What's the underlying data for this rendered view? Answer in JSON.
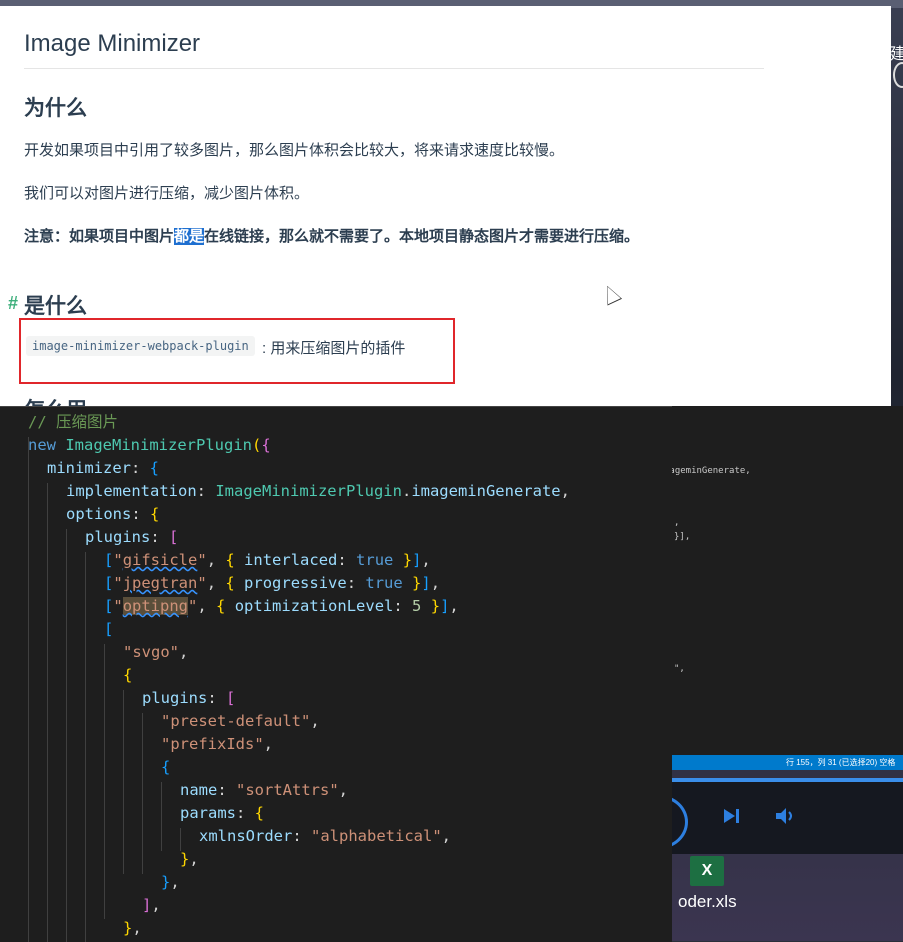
{
  "doc": {
    "title": "Image Minimizer",
    "sections": {
      "why": {
        "heading": "为什么",
        "p1": "开发如果项目中引用了较多图片，那么图片体积会比较大，将来请求速度比较慢。",
        "p2": "我们可以对图片进行压缩，减少图片体积。",
        "note_prefix": "注意：如果项目中图片",
        "note_highlight": "都是",
        "note_suffix": "在线链接，那么就不需要了。本地项目静态图片才需要进行压缩。"
      },
      "what": {
        "anchor": "#",
        "heading": "是什么",
        "code": "image-minimizer-webpack-plugin",
        "desc": ": 用来压缩图片的插件"
      },
      "how": {
        "heading_partial": "怎么用"
      }
    }
  },
  "code_editor": {
    "lines": [
      "// 压缩图片",
      "new ImageMinimizerPlugin({",
      "minimizer: {",
      "implementation: ImageMinimizerPlugin.imageminGenerate,",
      "options: {",
      "plugins: [",
      "[\"gifsicle\", { interlaced: true }],",
      "[\"jpegtran\", { progressive: true }],",
      "[\"optipng\", { optimizationLevel: 5 }],",
      "[",
      "\"svgo\",",
      "{",
      "plugins: [",
      "\"preset-default\",",
      "\"prefixIds\",",
      "{",
      "name: \"sortAttrs\",",
      "params: {",
      "xmlnsOrder: \"alphabetical\",",
      "},",
      "},",
      "],",
      "},"
    ]
  },
  "background": {
    "ide_snippets": [
      "mageminGenerate,",
      ",",
      "}],",
      "\","
    ],
    "status_bar": "行 155，列 31 (已选择20)   空格",
    "taskbar_file": "oder.xls",
    "xls_icon_letter": "X",
    "side_char": "建"
  },
  "colors": {
    "doc_text": "#2c3e50",
    "selection_highlight": "#1e6fd0",
    "red_box": "#e0262b",
    "code_bg": "#1e1e1e",
    "status_bar": "#007acc",
    "anchor": "#3eaf7c"
  },
  "icons": [
    "mouse-cursor-icon",
    "next-track-icon",
    "volume-icon",
    "excel-file-icon"
  ]
}
